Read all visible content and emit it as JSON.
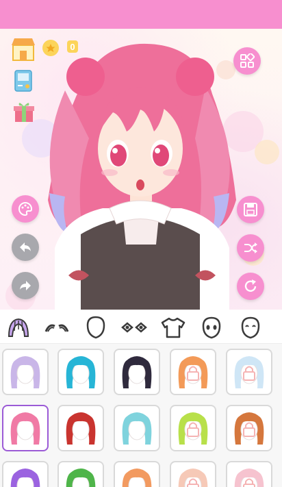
{
  "app": {
    "accent": "#f78fcf"
  },
  "currency": {
    "coins": "0",
    "coin_icon": "star-coin-icon"
  },
  "left_tools": [
    "shop-icon",
    "game-console-icon",
    "gift-icon"
  ],
  "side_buttons": {
    "palette": "palette-icon",
    "undo": "undo-icon",
    "redo": "redo-icon",
    "layout": "grid-icon",
    "save": "save-icon",
    "shuffle": "shuffle-icon",
    "reset": "refresh-icon"
  },
  "category_tabs": [
    {
      "id": "hair",
      "icon": "hair-icon",
      "selected": true
    },
    {
      "id": "eyebrows",
      "icon": "eyebrows-icon",
      "selected": false
    },
    {
      "id": "face",
      "icon": "face-shape-icon",
      "selected": false
    },
    {
      "id": "eyes",
      "icon": "eyes-icon",
      "selected": false
    },
    {
      "id": "clothes",
      "icon": "shirt-icon",
      "selected": false
    },
    {
      "id": "expression",
      "icon": "expression-icon",
      "selected": false
    },
    {
      "id": "smile",
      "icon": "smile-icon",
      "selected": false
    }
  ],
  "hair_options": [
    {
      "color": "#c9b6e8",
      "locked": false,
      "selected": false
    },
    {
      "color": "#27b5d6",
      "locked": false,
      "selected": false
    },
    {
      "color": "#2f2a3d",
      "locked": false,
      "selected": false
    },
    {
      "color": "#f39a58",
      "locked": true,
      "selected": false
    },
    {
      "color": "#cfe6f6",
      "locked": true,
      "selected": false
    },
    {
      "color": "#f07aa5",
      "locked": false,
      "selected": true
    },
    {
      "color": "#c9342f",
      "locked": false,
      "selected": false
    },
    {
      "color": "#7fd3dd",
      "locked": false,
      "selected": false
    },
    {
      "color": "#b8e04a",
      "locked": true,
      "selected": false
    },
    {
      "color": "#d5773d",
      "locked": true,
      "selected": false
    },
    {
      "color": "#9b63e0",
      "locked": false,
      "selected": false
    },
    {
      "color": "#4fb54a",
      "locked": false,
      "selected": false
    },
    {
      "color": "#f29a60",
      "locked": false,
      "selected": false
    },
    {
      "color": "#f6c9b7",
      "locked": true,
      "selected": false
    },
    {
      "color": "#f6c3cf",
      "locked": true,
      "selected": false
    }
  ]
}
